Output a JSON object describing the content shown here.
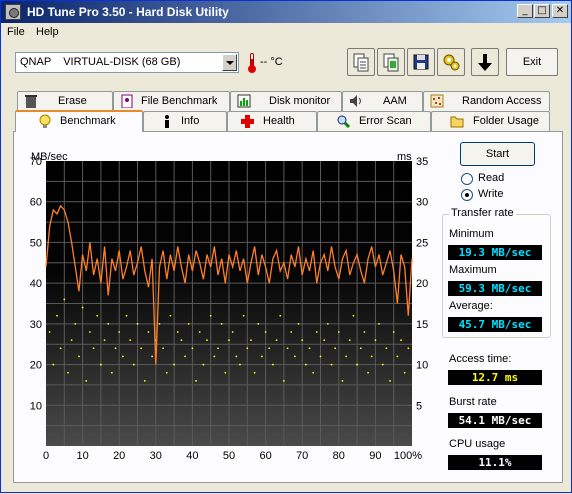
{
  "window": {
    "title": "HD Tune Pro 3.50 - Hard Disk Utility"
  },
  "menu": {
    "file": "File",
    "help": "Help"
  },
  "toolbar": {
    "drive": "QNAP    VIRTUAL-DISK (68 GB)",
    "temperature": "-- °C",
    "exit_label": "Exit",
    "buttons": [
      "copy-text-icon",
      "copy-screenshot-icon",
      "save-icon",
      "options-icon",
      "download-icon"
    ]
  },
  "tabs_top": [
    "Erase",
    "File Benchmark",
    "Disk monitor",
    "AAM",
    "Random Access"
  ],
  "tabs_bottom": [
    "Benchmark",
    "Info",
    "Health",
    "Error Scan",
    "Folder Usage"
  ],
  "active_tab": "Benchmark",
  "controls": {
    "start_label": "Start",
    "read_label": "Read",
    "write_label": "Write",
    "selected": "Write"
  },
  "transfer_rate": {
    "group_title": "Transfer rate",
    "minimum_label": "Minimum",
    "minimum_value": "19.3 MB/sec",
    "maximum_label": "Maximum",
    "maximum_value": "59.3 MB/sec",
    "average_label": "Average:",
    "average_value": "45.7 MB/sec"
  },
  "access_time": {
    "label": "Access time:",
    "value": "12.7 ms"
  },
  "burst_rate": {
    "label": "Burst rate",
    "value": "54.1 MB/sec"
  },
  "cpu_usage": {
    "label": "CPU usage",
    "value": "11.1%"
  },
  "chart_data": {
    "type": "line",
    "ylabel": "MB/sec",
    "y2label": "ms",
    "ylim": [
      0,
      70
    ],
    "y2lim": [
      0,
      35
    ],
    "xlim": [
      0,
      100
    ],
    "x_ticks": [
      "0",
      "10",
      "20",
      "30",
      "40",
      "50",
      "60",
      "70",
      "80",
      "90",
      "100%"
    ],
    "y_ticks": [
      "10",
      "20",
      "30",
      "40",
      "50",
      "60",
      "70"
    ],
    "y2_ticks": [
      "5",
      "10",
      "15",
      "20",
      "25",
      "30",
      "35"
    ],
    "grid": true,
    "series": [
      {
        "color": "#ff7f27",
        "x": [
          0,
          1,
          2,
          3,
          4,
          5,
          6,
          7,
          8,
          9,
          10,
          11,
          12,
          13,
          14,
          15,
          16,
          17,
          18,
          19,
          20,
          21,
          22,
          23,
          24,
          25,
          26,
          27,
          28,
          29,
          30,
          31,
          32,
          33,
          34,
          35,
          36,
          37,
          38,
          39,
          40,
          41,
          42,
          43,
          44,
          45,
          46,
          47,
          48,
          49,
          50,
          51,
          52,
          53,
          54,
          55,
          56,
          57,
          58,
          59,
          60,
          61,
          62,
          63,
          64,
          65,
          66,
          67,
          68,
          69,
          70,
          71,
          72,
          73,
          74,
          75,
          76,
          77,
          78,
          79,
          80,
          81,
          82,
          83,
          84,
          85,
          86,
          87,
          88,
          89,
          90,
          91,
          92,
          93,
          94,
          95,
          96,
          97,
          98,
          99,
          100
        ],
        "values": [
          44,
          54,
          58,
          57,
          59,
          58,
          55,
          50,
          44,
          38,
          47,
          43,
          50,
          42,
          46,
          40,
          49,
          37,
          46,
          43,
          48,
          41,
          44,
          48,
          42,
          45,
          49,
          43,
          39,
          46,
          20,
          44,
          48,
          41,
          47,
          43,
          49,
          44,
          40,
          47,
          43,
          48,
          45,
          41,
          47,
          44,
          49,
          42,
          46,
          40,
          47,
          44,
          48,
          43,
          46,
          40,
          45,
          49,
          42,
          47,
          44,
          40,
          46,
          48,
          43,
          45,
          41,
          47,
          44,
          49,
          42,
          46,
          43,
          48,
          40,
          45,
          47,
          43,
          49,
          44,
          41,
          46,
          48,
          42,
          45,
          47,
          43,
          40,
          46,
          49,
          44,
          47,
          42,
          45,
          48,
          43,
          35,
          47,
          44,
          32,
          46
        ]
      },
      {
        "type": "scatter",
        "color": "#ffff00",
        "x": [
          1,
          2,
          3,
          4,
          5,
          6,
          7,
          8,
          9,
          10,
          11,
          12,
          13,
          14,
          15,
          16,
          17,
          18,
          19,
          20,
          21,
          22,
          23,
          24,
          25,
          26,
          27,
          28,
          29,
          30,
          31,
          32,
          33,
          34,
          35,
          36,
          37,
          38,
          39,
          40,
          41,
          42,
          43,
          44,
          45,
          46,
          47,
          48,
          49,
          50,
          51,
          52,
          53,
          54,
          55,
          56,
          57,
          58,
          59,
          60,
          61,
          62,
          63,
          64,
          65,
          66,
          67,
          68,
          69,
          70,
          71,
          72,
          73,
          74,
          75,
          76,
          77,
          78,
          79,
          80,
          81,
          82,
          83,
          84,
          85,
          86,
          87,
          88,
          89,
          90,
          91,
          92,
          93,
          94,
          95,
          96,
          97,
          98,
          99
        ],
        "values": [
          14,
          10,
          16,
          12,
          18,
          9,
          13,
          15,
          11,
          17,
          8,
          14,
          12,
          16,
          10,
          13,
          15,
          9,
          12,
          14,
          11,
          16,
          13,
          10,
          15,
          12,
          8,
          14,
          11,
          13,
          15,
          12,
          9,
          16,
          10,
          14,
          13,
          11,
          15,
          12,
          8,
          14,
          10,
          13,
          16,
          11,
          12,
          15,
          9,
          13,
          14,
          11,
          10,
          16,
          12,
          13,
          9,
          15,
          11,
          14,
          12,
          10,
          13,
          16,
          8,
          12,
          14,
          11,
          15,
          13,
          10,
          12,
          9,
          14,
          11,
          13,
          15,
          10,
          12,
          14,
          8,
          11,
          13,
          16,
          10,
          12,
          14,
          9,
          11,
          13,
          15,
          10,
          12,
          8,
          14,
          11,
          13,
          9,
          12
        ]
      }
    ]
  }
}
